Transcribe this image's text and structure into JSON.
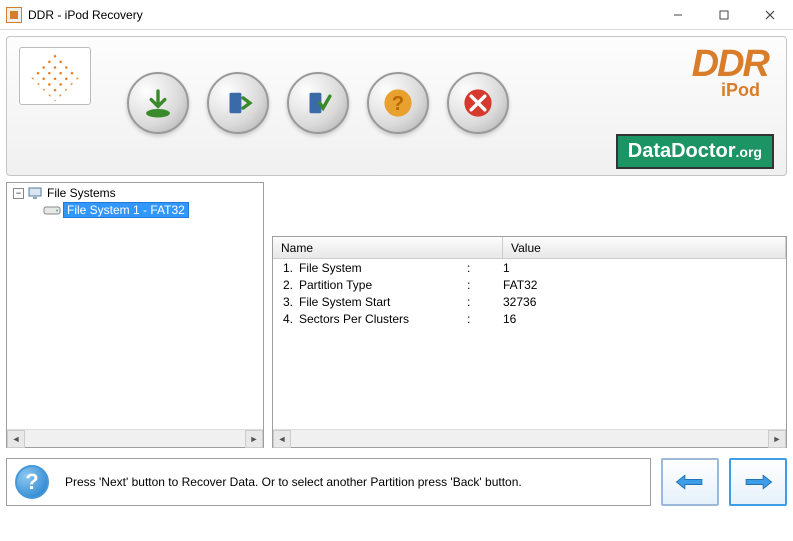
{
  "window": {
    "title": "DDR - iPod Recovery"
  },
  "brand": {
    "ddr": "DDR",
    "ipod": "iPod",
    "site": "DataDoctor",
    "site_suffix": ".org"
  },
  "tree": {
    "root_label": "File Systems",
    "child_label": "File System 1 - FAT32"
  },
  "table": {
    "header_name": "Name",
    "header_value": "Value",
    "rows": [
      {
        "idx": "1.",
        "name": "File System",
        "value": "1"
      },
      {
        "idx": "2.",
        "name": "Partition Type",
        "value": "FAT32"
      },
      {
        "idx": "3.",
        "name": "File System Start",
        "value": "32736"
      },
      {
        "idx": "4.",
        "name": "Sectors Per Clusters",
        "value": "16"
      }
    ]
  },
  "footer": {
    "message": "Press 'Next' button to Recover Data. Or to select another Partition press 'Back' button."
  }
}
